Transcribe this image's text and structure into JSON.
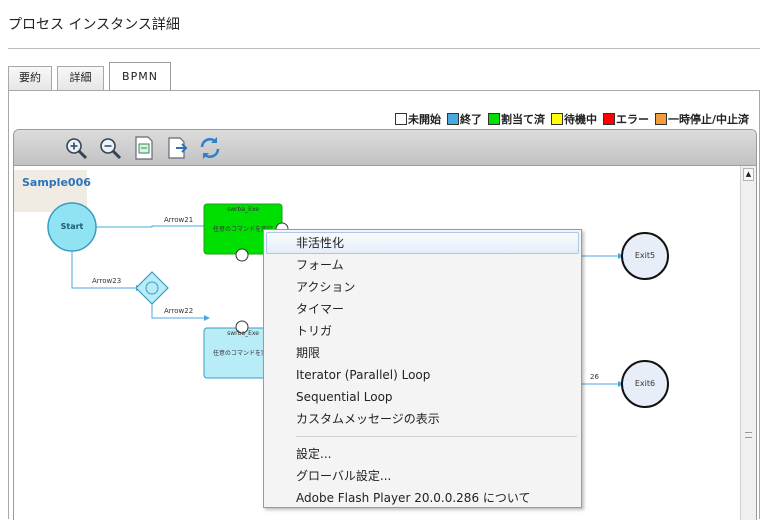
{
  "page": {
    "title": "プロセス インスタンス詳細"
  },
  "tabs": [
    {
      "label": "要約"
    },
    {
      "label": "詳細"
    },
    {
      "label": "BPMN"
    }
  ],
  "legend": [
    {
      "label": "未開始",
      "color": "#ffffff"
    },
    {
      "label": "終了",
      "color": "#4aa8e0"
    },
    {
      "label": "割当て済",
      "color": "#00e000"
    },
    {
      "label": "待機中",
      "color": "#ffff00"
    },
    {
      "label": "エラー",
      "color": "#ff0000"
    },
    {
      "label": "一時停止/中止済",
      "color": "#f29c3a"
    }
  ],
  "toolbar": {
    "icons": [
      "zoom-in-icon",
      "zoom-out-icon",
      "fit-page-icon",
      "export-icon",
      "refresh-icon"
    ]
  },
  "diagram": {
    "process_name": "Sample006",
    "start_label": "Start",
    "task1_title": "swrba_Exe",
    "task1_text": "任意のコマンドを実行",
    "task2_title": "swrba_Exe",
    "task2_text": "任意のコマンドを実行",
    "exit5_label": "Exit5",
    "exit6_label": "Exit6",
    "edges": {
      "arrow21": "Arrow21",
      "arrow22": "Arrow22",
      "arrow23": "Arrow23",
      "partial": "26"
    },
    "colors": {
      "assigned": "#00e000",
      "completed": "#b8ecf6",
      "start_fill": "#8fe3f2",
      "exit_fill": "#e8eef8",
      "edge": "#4aa8e0"
    }
  },
  "context_menu": {
    "items": [
      "非活性化",
      "フォーム",
      "アクション",
      "タイマー",
      "トリガ",
      "期限",
      "Iterator (Parallel) Loop",
      "Sequential Loop",
      "カスタムメッセージの表示"
    ],
    "items2": [
      "設定...",
      "グローバル設定...",
      "Adobe Flash Player 20.0.0.286  について"
    ]
  }
}
